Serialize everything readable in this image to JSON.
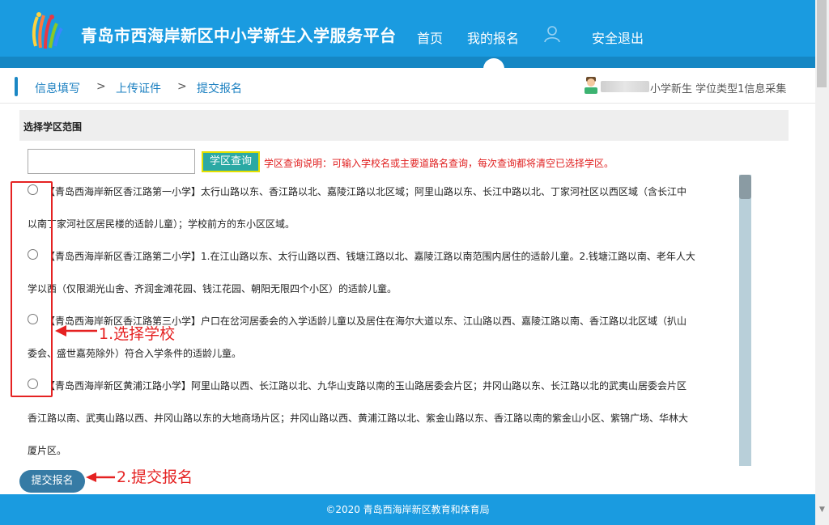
{
  "header": {
    "title": "青岛市西海岸新区中小学新生入学服务平台",
    "nav": {
      "home": "首页",
      "my_registration": "我的报名",
      "logout": "安全退出"
    }
  },
  "breadcrumb": {
    "step1": "信息填写",
    "step2": "上传证件",
    "step3": "提交报名",
    "separator": ">"
  },
  "user": {
    "info": "小学新生 学位类型1信息采集"
  },
  "section": {
    "title": "选择学区范围"
  },
  "search": {
    "value": "",
    "button_label": "学区查询",
    "hint": "学区查询说明：可输入学校名或主要道路名查询，每次查询都将清空已选择学区。"
  },
  "schools": [
    {
      "line1": "【青岛西海岸新区香江路第一小学】太行山路以东、香江路以北、嘉陵江路以北区域；阿里山路以东、长江中路以北、丁家河社区以西区域（含长江中",
      "line2": "以南丁家河社区居民楼的适龄儿童）；学校前方的东小区区域。"
    },
    {
      "line1": "【青岛西海岸新区香江路第二小学】1.在江山路以东、太行山路以西、钱塘江路以北、嘉陵江路以南范围内居住的适龄儿童。2.钱塘江路以南、老年人大",
      "line2": "学以西（仅限湖光山舍、齐润金滩花园、钱江花园、朝阳无限四个小区）的适龄儿童。"
    },
    {
      "line1": "【青岛西海岸新区香江路第三小学】户口在岔河居委会的入学适龄儿童以及居住在海尔大道以东、江山路以西、嘉陵江路以南、香江路以北区域（扒山",
      "line2": "委会、盛世嘉苑除外）符合入学条件的适龄儿童。"
    },
    {
      "line1": "【青岛西海岸新区黄浦江路小学】阿里山路以西、长江路以北、九华山支路以南的玉山路居委会片区；井冈山路以东、长江路以北的武夷山居委会片区",
      "line2": "香江路以南、武夷山路以西、井冈山路以东的大地商场片区；井冈山路以西、黄浦江路以北、紫金山路以东、香江路以南的紫金山小区、紫锦广场、华林大",
      "line3": "厦片区。"
    }
  ],
  "annotations": {
    "step1": "1.选择学校",
    "step2": "2.提交报名"
  },
  "submit": {
    "label": "提交报名"
  },
  "footer": {
    "text": "©2020 青岛西海岸新区教育和体育局"
  },
  "colors": {
    "header_blue": "#1a9be0",
    "header_band": "#1587c4",
    "link_blue": "#1a7fc0",
    "hint_red": "#e02020",
    "annotation_red": "#e52222",
    "search_button": "#2ba9a4",
    "submit_button": "#367ba5"
  }
}
